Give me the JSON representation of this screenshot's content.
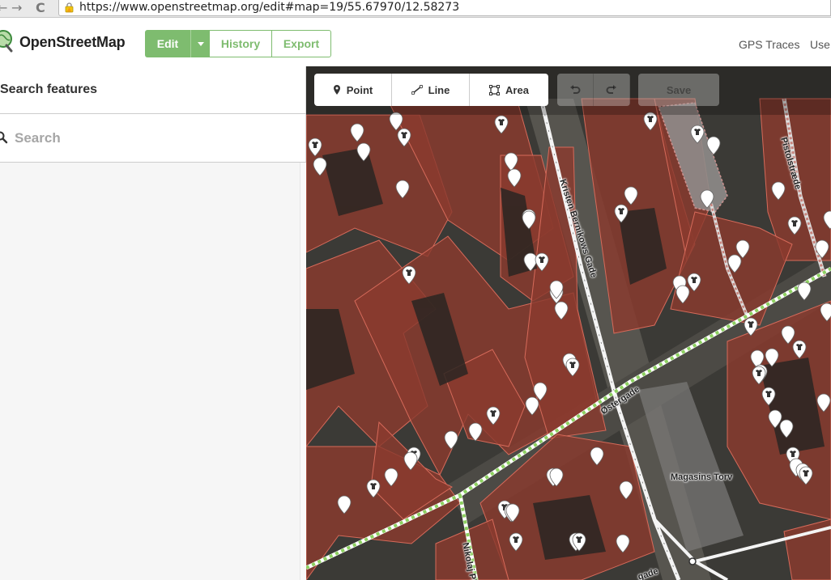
{
  "browser": {
    "url": "https://www.openstreetmap.org/edit#map=19/55.67970/12.58273",
    "back_glyph": "←",
    "forward_glyph": "→",
    "reload_glyph": "C"
  },
  "header": {
    "logo_text": "OpenStreetMap",
    "edit_label": "Edit",
    "history_label": "History",
    "export_label": "Export",
    "gps_traces_label": "GPS Traces",
    "user_diaries_label": "Use",
    "accent_color": "#7ebc6f"
  },
  "sidebar": {
    "title": "Search features",
    "search_placeholder": "Search"
  },
  "map": {
    "toolbar": {
      "point_label": "Point",
      "line_label": "Line",
      "area_label": "Area",
      "save_label": "Save"
    },
    "streets": {
      "kristen": "Kristen Bernikows Gade",
      "pistol": "Pistolstræde",
      "oster": "Østergade",
      "magasins": "Magasins Torv",
      "nikolaj": "Nikolaj Pl",
      "bottom_partial": "gade"
    },
    "building_color": "#8b3a2e",
    "footway_color": "#8cd05f"
  }
}
